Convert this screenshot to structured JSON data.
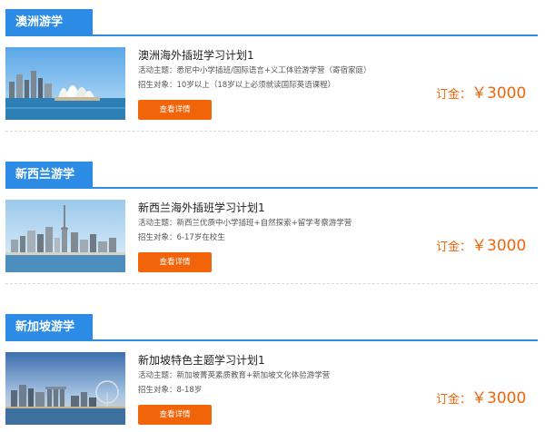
{
  "sections": [
    {
      "heading": "澳洲游学",
      "title": "澳洲海外插班学习计划1",
      "theme": "活动主题：悉尼中小学插班/国际语言+义工体验游学营（寄宿家庭）",
      "target": "招生对象：10岁以上（18岁以上必须就读国际英语课程）",
      "button": "查看详情",
      "price_label": "订金：",
      "price_value": "￥3000",
      "image_icon": "sydney-opera-house-photo"
    },
    {
      "heading": "新西兰游学",
      "title": "新西兰海外插班学习计划1",
      "theme": "活动主题：新西兰优质中小学插班+自然探索+留学考察游学营",
      "target": "招生对象：6-17岁在校生",
      "button": "查看详情",
      "price_label": "订金：",
      "price_value": "￥3000",
      "image_icon": "auckland-skyline-photo"
    },
    {
      "heading": "新加坡游学",
      "title": "新加坡特色主题学习计划1",
      "theme": "活动主题：新加坡菁英素质教育+新加坡文化体验游学营",
      "target": "招生对象：8-18岁",
      "button": "查看详情",
      "price_label": "订金：",
      "price_value": "￥3000",
      "image_icon": "singapore-skyline-photo"
    }
  ],
  "colors": {
    "accent_blue": "#2b8be5",
    "accent_orange": "#f2640a"
  }
}
